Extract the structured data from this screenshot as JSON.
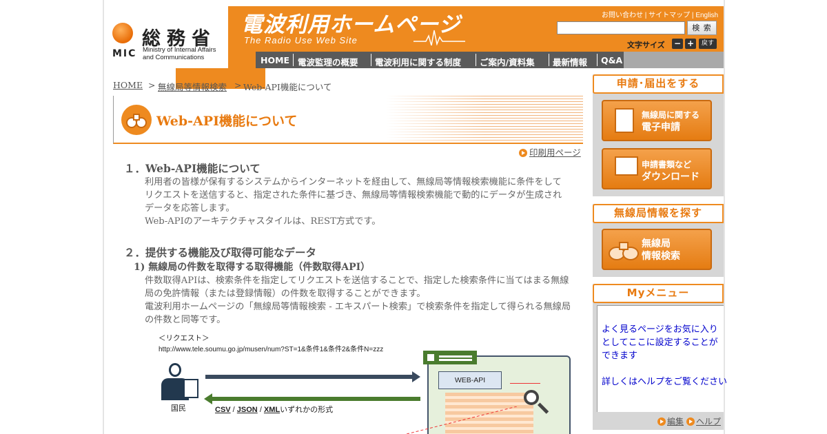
{
  "header": {
    "logo_kanji": "総務省",
    "logo_abbr": "MIC",
    "logo_en_line1": "Ministry of Internal Affairs",
    "logo_en_line2": "and Communications",
    "site_title": "電波利用ホームページ",
    "site_subtitle": "The Radio Use Web Site",
    "top_links": [
      "お問い合わせ",
      "サイトマップ",
      "English"
    ],
    "search_placeholder": "",
    "search_button": "検 索",
    "font_size_label": "文字サイズ",
    "font_minus": "−",
    "font_plus": "+",
    "font_reset": "戻す",
    "nav": [
      "HOME",
      "電波監理の概要",
      "電波利用に関する制度",
      "ご案内/資料集",
      "最新情報",
      "Q&A"
    ]
  },
  "breadcrumb": {
    "home": "HOME",
    "sep": ">",
    "item1": "無線局等情報検索",
    "current": "Web-API機能について"
  },
  "page": {
    "title": "Web-API機能について",
    "print_link": "印刷用ページ",
    "section1_heading": "１．Web-API機能について",
    "section1_lines": [
      "利用者の皆様が保有するシステムからインターネットを経由して、無線局等情報検索機能に条件をして",
      "リクエストを送信すると、指定された条件に基づき、無線局等情報検索機能で動的にデータが生成され",
      "データを応答します。",
      "Web-APIのアーキテクチャスタイルは、REST方式です。"
    ],
    "section2_heading": "２．提供する機能及び取得可能なデータ",
    "section2_sub1": "1) 無線局の件数を取得する取得機能（件数取得API）",
    "section2_lines": [
      "件数取得APIは、検索条件を指定してリクエストを送信することで、指定した検索条件に当てはまる無線",
      "局の免許情報（または登録情報）の件数を取得することができます。",
      "電波利用ホームページの「無線局等情報検索 - エキスパート検索」で検索条件を指定して得られる無線局",
      "の件数と同等です。"
    ]
  },
  "diagram": {
    "request_label": "＜リクエスト＞",
    "request_url": "http://www.tele.soumu.go.jp/musen/num?ST=1&条件1&条件2&条件N=zzz",
    "citizen_label": "国民",
    "format_csv": "CSV",
    "format_json": "JSON",
    "format_xml": "XML",
    "format_suffix": "いずれかの形式",
    "server_label": "WEB-API"
  },
  "sidebar": {
    "apply_heading": "申請･届出をする",
    "apply_btn1_line1": "無線局に関する",
    "apply_btn1_line2": "電子申請",
    "apply_btn2_line1": "申請書類など",
    "apply_btn2_line2": "ダウンロード",
    "search_heading": "無線局情報を探す",
    "search_btn_line1": "無線局",
    "search_btn_line2": "情報検索",
    "mymenu_heading": "Myメニュー",
    "mymenu_lines": [
      "よく見るページをお気に入り",
      "としてここに設定することが",
      "できます"
    ],
    "mymenu_help": "詳しくはヘルプをご覧ください",
    "edit_link": "編集",
    "help_link": "ヘルプ"
  },
  "colors": {
    "brand_orange": "#ee8a1f",
    "nav_gray": "#5a5a5a",
    "arrow_navy": "#3a4a5e",
    "arrow_green": "#4a7c2e"
  }
}
